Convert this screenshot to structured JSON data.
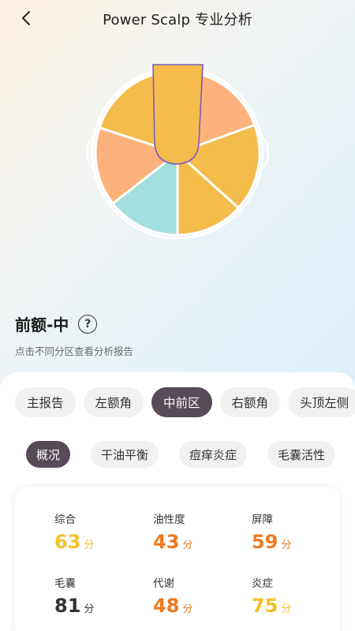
{
  "header": {
    "title": "Power Scalp 专业分析"
  },
  "colors": {
    "region_yellow": "#f3bc4b",
    "region_orange": "#fdb27b",
    "region_teal": "#a3dfdc",
    "selected_outline": "#7b5cc0",
    "score_yellow": "#f4bf27",
    "score_orange": "#ee7a1f",
    "score_dark": "#333333",
    "active_tab": "#574b58"
  },
  "scalp_map": {
    "regions": [
      {
        "name": "front-center",
        "color": "yellow",
        "selected": true
      },
      {
        "name": "front-right",
        "color": "orange"
      },
      {
        "name": "side-right",
        "color": "yellow"
      },
      {
        "name": "back-right",
        "color": "yellow"
      },
      {
        "name": "back",
        "color": "teal"
      },
      {
        "name": "side-left",
        "color": "orange"
      },
      {
        "name": "front-left",
        "color": "yellow"
      }
    ]
  },
  "region": {
    "title": "前额-中",
    "help_icon": "?",
    "hint": "点击不同分区查看分析报告"
  },
  "zone_tabs": [
    {
      "label": "主报告",
      "active": false
    },
    {
      "label": "左额角",
      "active": false
    },
    {
      "label": "中前区",
      "active": true
    },
    {
      "label": "右额角",
      "active": false
    },
    {
      "label": "头顶左侧",
      "active": false
    }
  ],
  "sub_tabs": [
    {
      "label": "概况",
      "active": true
    },
    {
      "label": "干油平衡",
      "active": false
    },
    {
      "label": "痘痒炎症",
      "active": false
    },
    {
      "label": "毛囊活性",
      "active": false
    }
  ],
  "scores": [
    {
      "label": "综合",
      "value": "63",
      "unit": "分",
      "color": "#f4bf27"
    },
    {
      "label": "油性度",
      "value": "43",
      "unit": "分",
      "color": "#ee7a1f"
    },
    {
      "label": "屏障",
      "value": "59",
      "unit": "分",
      "color": "#ee7a1f"
    },
    {
      "label": "毛囊",
      "value": "81",
      "unit": "分",
      "color": "#333333"
    },
    {
      "label": "代谢",
      "value": "48",
      "unit": "分",
      "color": "#ee7a1f"
    },
    {
      "label": "炎症",
      "value": "75",
      "unit": "分",
      "color": "#f4bf27"
    }
  ]
}
